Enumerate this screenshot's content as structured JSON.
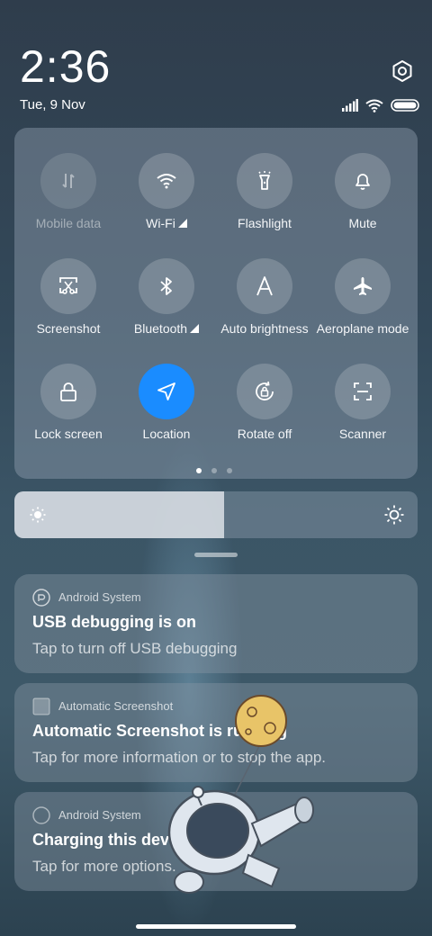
{
  "status": {
    "time": "2:36",
    "date": "Tue, 9 Nov"
  },
  "quick_settings": {
    "tiles": [
      {
        "label": "Mobile data",
        "icon": "mobile-data-icon",
        "state": "disabled"
      },
      {
        "label": "Wi-Fi",
        "icon": "wifi-icon",
        "state": "off",
        "has_more": true
      },
      {
        "label": "Flashlight",
        "icon": "flashlight-icon",
        "state": "off"
      },
      {
        "label": "Mute",
        "icon": "bell-icon",
        "state": "off"
      },
      {
        "label": "Screenshot",
        "icon": "screenshot-icon",
        "state": "off"
      },
      {
        "label": "Bluetooth",
        "icon": "bluetooth-icon",
        "state": "off",
        "has_more": true
      },
      {
        "label": "Auto brightness",
        "icon": "auto-brightness-icon",
        "state": "off"
      },
      {
        "label": "Aeroplane mode",
        "icon": "airplane-icon",
        "state": "off"
      },
      {
        "label": "Lock screen",
        "icon": "lock-icon",
        "state": "off"
      },
      {
        "label": "Location",
        "icon": "location-icon",
        "state": "on"
      },
      {
        "label": "Rotate off",
        "icon": "rotate-lock-icon",
        "state": "off"
      },
      {
        "label": "Scanner",
        "icon": "scanner-icon",
        "state": "off"
      }
    ],
    "page_count": 3,
    "current_page": 1,
    "accent_color": "#1a8cff"
  },
  "brightness": {
    "level_percent": 52
  },
  "notifications": [
    {
      "app": "Android System",
      "title": "USB debugging is on",
      "body": "Tap to turn off USB debugging",
      "icon": "android-system-icon"
    },
    {
      "app": "Automatic Screenshot",
      "title": "Automatic Screenshot is running",
      "body": "Tap for more information or to stop the app.",
      "icon": "auto-screenshot-app-icon"
    },
    {
      "app": "Android System",
      "title": "Charging this device via USB",
      "body": "Tap for more options.",
      "icon": "android-system-icon"
    }
  ]
}
